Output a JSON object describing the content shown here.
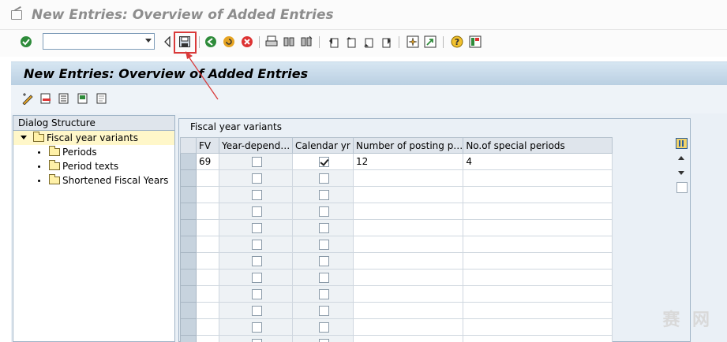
{
  "window": {
    "title": "New Entries: Overview of Added Entries"
  },
  "page": {
    "title": "New Entries: Overview of Added Entries"
  },
  "command_field": {
    "value": ""
  },
  "tree": {
    "header": "Dialog Structure",
    "items": [
      {
        "label": "Fiscal year variants",
        "level": 0,
        "selected": true,
        "expanded": true
      },
      {
        "label": "Periods",
        "level": 1
      },
      {
        "label": "Period texts",
        "level": 1
      },
      {
        "label": "Shortened Fiscal Years",
        "level": 1
      }
    ]
  },
  "table": {
    "title": "Fiscal year variants",
    "columns": [
      "FV",
      "Year-depend…",
      "Calendar yr",
      "Number of posting p…",
      "No.of special periods"
    ],
    "rows": [
      {
        "fv": "69",
        "year_dependent": false,
        "calendar_year": true,
        "posting_periods": "12",
        "special_periods": "4"
      },
      {
        "fv": "",
        "year_dependent": false,
        "calendar_year": false,
        "posting_periods": "",
        "special_periods": ""
      },
      {
        "fv": "",
        "year_dependent": false,
        "calendar_year": false,
        "posting_periods": "",
        "special_periods": ""
      },
      {
        "fv": "",
        "year_dependent": false,
        "calendar_year": false,
        "posting_periods": "",
        "special_periods": ""
      },
      {
        "fv": "",
        "year_dependent": false,
        "calendar_year": false,
        "posting_periods": "",
        "special_periods": ""
      },
      {
        "fv": "",
        "year_dependent": false,
        "calendar_year": false,
        "posting_periods": "",
        "special_periods": ""
      },
      {
        "fv": "",
        "year_dependent": false,
        "calendar_year": false,
        "posting_periods": "",
        "special_periods": ""
      },
      {
        "fv": "",
        "year_dependent": false,
        "calendar_year": false,
        "posting_periods": "",
        "special_periods": ""
      },
      {
        "fv": "",
        "year_dependent": false,
        "calendar_year": false,
        "posting_periods": "",
        "special_periods": ""
      },
      {
        "fv": "",
        "year_dependent": false,
        "calendar_year": false,
        "posting_periods": "",
        "special_periods": ""
      },
      {
        "fv": "",
        "year_dependent": false,
        "calendar_year": false,
        "posting_periods": "",
        "special_periods": ""
      },
      {
        "fv": "",
        "year_dependent": false,
        "calendar_year": false,
        "posting_periods": "",
        "special_periods": ""
      }
    ]
  },
  "colors": {
    "annotation": "#d93a3a",
    "band": "#c4d7e8",
    "tree_selection": "#fff7c9"
  },
  "icons": {
    "system_toolbar": [
      "enter-icon",
      "command-field-dropdown-icon",
      "save-icon",
      "back-icon",
      "exit-icon",
      "cancel-icon",
      "print-icon",
      "find-icon",
      "find-next-icon",
      "first-page-icon",
      "previous-page-icon",
      "next-page-icon",
      "last-page-icon",
      "create-session-icon",
      "shortcut-icon",
      "help-icon",
      "layout-icon"
    ],
    "application_toolbar": [
      "change-display-icon",
      "delete-icon",
      "select-all-icon",
      "select-block-icon",
      "deselect-all-icon"
    ]
  },
  "watermark": "赛 网"
}
